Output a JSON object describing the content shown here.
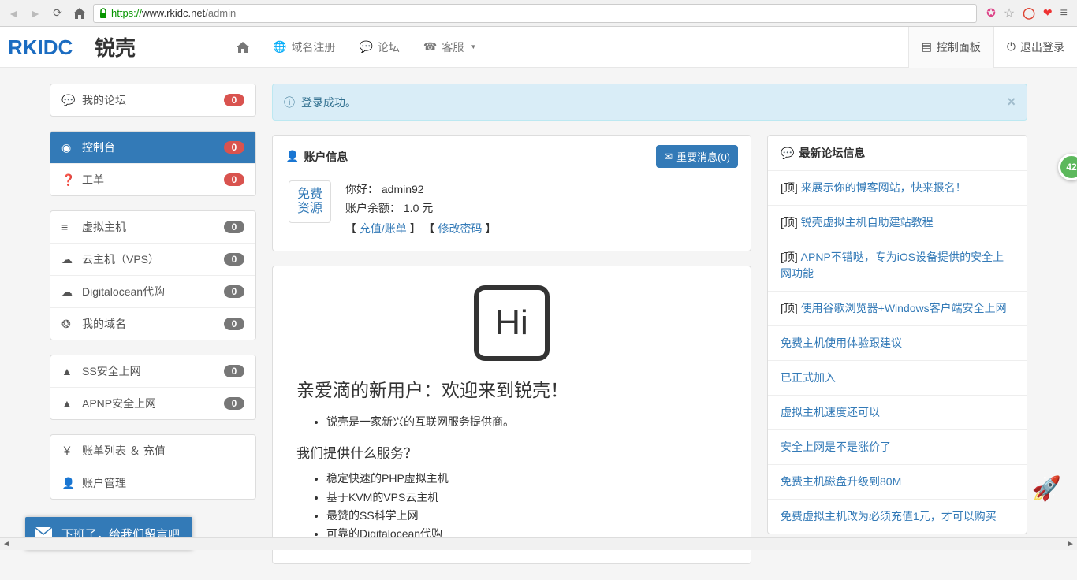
{
  "browser": {
    "url_https": "https://",
    "url_host": "www.rkidc.net",
    "url_path": "/admin"
  },
  "header": {
    "logo_text1": "RKIDC",
    "logo_text2": "锐壳",
    "nav": {
      "home": "",
      "domain": "域名注册",
      "forum": "论坛",
      "cs": "客服"
    },
    "right": {
      "panel": "控制面板",
      "logout": "退出登录"
    }
  },
  "sidebar": {
    "g1": [
      {
        "label": "我的论坛",
        "badge": "0",
        "badgeRed": true,
        "iconName": "comment-icon"
      }
    ],
    "g2": [
      {
        "label": "控制台",
        "badge": "0",
        "badgeRed": true,
        "active": true,
        "iconName": "dashboard-icon"
      },
      {
        "label": "工单",
        "badge": "0",
        "badgeRed": true,
        "iconName": "question-icon"
      }
    ],
    "g3": [
      {
        "label": "虚拟主机",
        "badge": "0",
        "iconName": "list-icon"
      },
      {
        "label": "云主机（VPS）",
        "badge": "0",
        "iconName": "cloud-icon"
      },
      {
        "label": "Digitalocean代购",
        "badge": "0",
        "iconName": "cloud-solid-icon"
      },
      {
        "label": "我的域名",
        "badge": "0",
        "iconName": "globe-icon"
      }
    ],
    "g4": [
      {
        "label": "SS安全上网",
        "badge": "0",
        "iconName": "road-icon"
      },
      {
        "label": "APNP安全上网",
        "badge": "0",
        "iconName": "road-icon"
      }
    ],
    "g5": [
      {
        "label": "账单列表 ＆ 充值",
        "iconName": "yen-icon"
      },
      {
        "label": "账户管理",
        "iconName": "user-icon"
      }
    ]
  },
  "alert": {
    "text": "登录成功。"
  },
  "account": {
    "title": "账户信息",
    "msg_btn": "重要消息(0)",
    "icon_line1": "免费",
    "icon_line2": "资源",
    "hello_prefix": "你好：",
    "username": "admin92",
    "balance_prefix": "账户余额：",
    "balance": "1.0 元",
    "link1": "充值/账单",
    "link2": "修改密码"
  },
  "welcome": {
    "hi": "Hi",
    "h1": "亲爱滴的新用户：欢迎来到锐壳！",
    "intro": "锐壳是一家新兴的互联网服务提供商。",
    "h2": "我们提供什么服务？",
    "services": [
      "稳定快速的PHP虚拟主机",
      "基于KVM的VPS云主机",
      "最赞的SS科学上网",
      "可靠的Digitalocean代购"
    ]
  },
  "forum": {
    "title": "最新论坛信息",
    "items": [
      {
        "tag": "[顶]",
        "text": "来展示你的博客网站，快来报名！"
      },
      {
        "tag": "[顶]",
        "text": "锐壳虚拟主机自助建站教程"
      },
      {
        "tag": "[顶]",
        "text": "APNP不错哒，专为iOS设备提供的安全上网功能"
      },
      {
        "tag": "[顶]",
        "text": "使用谷歌浏览器+Windows客户端安全上网"
      },
      {
        "tag": "",
        "text": "免费主机使用体验跟建议"
      },
      {
        "tag": "",
        "text": "已正式加入"
      },
      {
        "tag": "",
        "text": "虚拟主机速度还可以"
      },
      {
        "tag": "",
        "text": "安全上网是不是涨价了"
      },
      {
        "tag": "",
        "text": "免费主机磁盘升级到80M"
      },
      {
        "tag": "",
        "text": "免费虚拟主机改为必须充值1元，才可以购买"
      }
    ]
  },
  "chat": {
    "text": "下班了，给我们留言吧"
  },
  "float": {
    "count": "42"
  }
}
